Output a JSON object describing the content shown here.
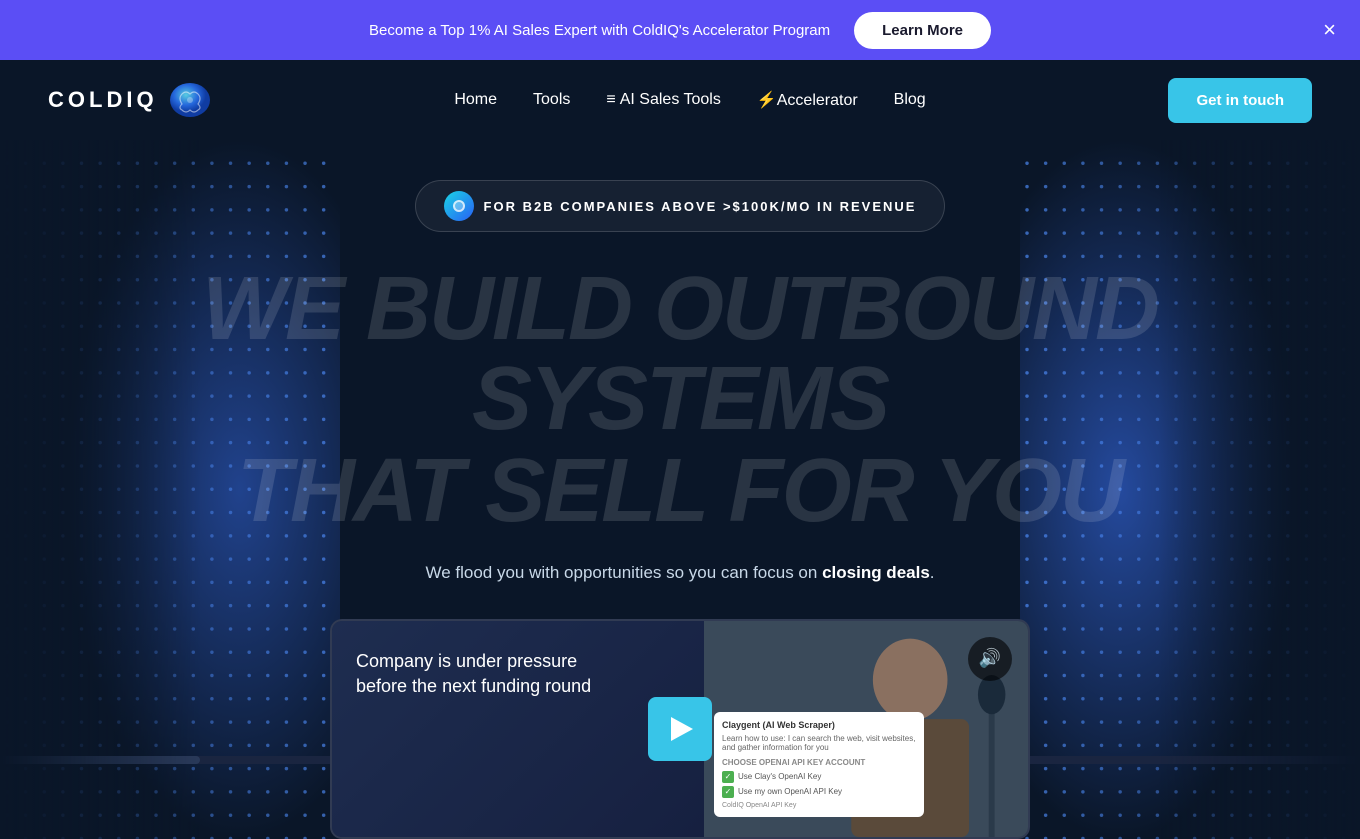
{
  "banner": {
    "text": "Become a Top 1% AI Sales Expert with ColdIQ's Accelerator Program",
    "cta_label": "Learn More",
    "close_label": "×"
  },
  "nav": {
    "logo_text": "COLDIQ",
    "links": [
      {
        "label": "Home",
        "icon": ""
      },
      {
        "label": "Tools",
        "icon": ""
      },
      {
        "label": "AI Sales Tools",
        "icon": "≡ "
      },
      {
        "label": "⚡Accelerator",
        "icon": ""
      },
      {
        "label": "Blog",
        "icon": ""
      }
    ],
    "cta_label": "Get in touch"
  },
  "hero": {
    "badge_text": "FOR B2B COMPANIES ABOVE >$100K/MO IN REVENUE",
    "headline_line1": "WE BUILD OUTBOUND SYSTEMS",
    "headline_line2": "THAT SELL FOR YOU",
    "subtext": "We flood you with opportunities so you can focus on",
    "subtext_bold": "closing deals",
    "subtext_end": ".",
    "video": {
      "title_line1": "Company is under pressure",
      "title_line2": "before the next funding round",
      "screen_title": "Claygent (AI Web Scraper)",
      "screen_desc": "Learn how to use: I can search the web, visit websites, and gather information for you",
      "screen_section": "CHOOSE OPENAI API KEY ACCOUNT",
      "option1": "Use Clay's OpenAI Key",
      "option2": "Use my own OpenAI API Key",
      "api_label": "ColdIQ OpenAI API Key"
    }
  }
}
